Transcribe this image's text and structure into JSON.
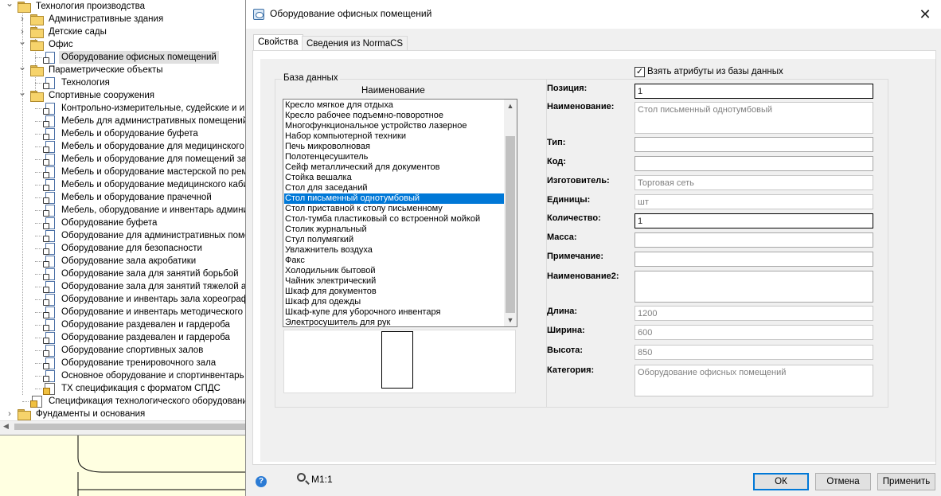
{
  "tree": {
    "nodes": [
      {
        "label": "Технология производства",
        "icon": "folder-icon",
        "toggle": "expanded"
      },
      {
        "label": "Административные здания",
        "icon": "folder-icon",
        "toggle": "collapsed"
      },
      {
        "label": "Детские сады",
        "icon": "folder-icon",
        "toggle": "collapsed"
      },
      {
        "label": "Офис",
        "icon": "folder-icon",
        "toggle": "expanded"
      },
      {
        "label": "Оборудование офисных помещений",
        "icon": "document-icon",
        "toggle": "none",
        "selected": true
      },
      {
        "label": "Параметрические объекты",
        "icon": "folder-icon",
        "toggle": "expanded"
      },
      {
        "label": "Технология",
        "icon": "document-icon",
        "toggle": "none"
      },
      {
        "label": "Спортивные сооружения",
        "icon": "folder-icon",
        "toggle": "expanded"
      },
      {
        "label": "Контрольно-измерительные, судейские и ин",
        "icon": "document-icon",
        "toggle": "none"
      },
      {
        "label": "Мебель для административных помещений",
        "icon": "document-icon",
        "toggle": "none"
      },
      {
        "label": "Мебель и оборудование буфета",
        "icon": "document-icon",
        "toggle": "none"
      },
      {
        "label": "Мебель и оборудование для медицинского к",
        "icon": "document-icon",
        "toggle": "none"
      },
      {
        "label": "Мебель и оборудование для помещений зат",
        "icon": "document-icon",
        "toggle": "none"
      },
      {
        "label": "Мебель и оборудование мастерской по ремс",
        "icon": "document-icon",
        "toggle": "none"
      },
      {
        "label": "Мебель и оборудование медицинского каби",
        "icon": "document-icon",
        "toggle": "none"
      },
      {
        "label": "Мебель и оборудование прачечной",
        "icon": "document-icon",
        "toggle": "none"
      },
      {
        "label": "Мебель, оборудование и инвентарь админис",
        "icon": "document-icon",
        "toggle": "none"
      },
      {
        "label": "Оборудование буфета",
        "icon": "document-icon",
        "toggle": "none"
      },
      {
        "label": "Оборудование для административных помещ",
        "icon": "document-icon",
        "toggle": "none"
      },
      {
        "label": "Оборудование для безопасности",
        "icon": "document-icon",
        "toggle": "none"
      },
      {
        "label": "Оборудование зала акробатики",
        "icon": "document-icon",
        "toggle": "none"
      },
      {
        "label": "Оборудование зала для занятий борьбой",
        "icon": "document-icon",
        "toggle": "none"
      },
      {
        "label": "Оборудование зала для занятий тяжелой ат",
        "icon": "document-icon",
        "toggle": "none"
      },
      {
        "label": "Оборудование и инвентарь зала хореографи",
        "icon": "document-icon",
        "toggle": "none"
      },
      {
        "label": "Оборудование и инвентарь методического к",
        "icon": "document-icon",
        "toggle": "none"
      },
      {
        "label": "Оборудование раздевален и гардероба",
        "icon": "document-icon",
        "toggle": "none"
      },
      {
        "label": "Оборудование раздевален и гардероба",
        "icon": "document-icon",
        "toggle": "none"
      },
      {
        "label": "Оборудование спортивных залов",
        "icon": "document-icon",
        "toggle": "none"
      },
      {
        "label": "Оборудование тренировочного зала",
        "icon": "document-icon",
        "toggle": "none"
      },
      {
        "label": "Основное оборудование и спортинвентарь",
        "icon": "document-icon",
        "toggle": "none"
      },
      {
        "label": "ТХ спецификация с форматом СПДС",
        "icon": "spec-document-icon",
        "toggle": "none"
      },
      {
        "label": "Спецификация технологического оборудования",
        "icon": "spec-table-icon",
        "toggle": "none"
      },
      {
        "label": "Фундаменты и основания",
        "icon": "folder-icon",
        "toggle": "collapsed"
      }
    ]
  },
  "dialog": {
    "title": "Оборудование офисных помещений",
    "close_glyph": "✕",
    "tabs": [
      {
        "label": "Свойства",
        "active": true
      },
      {
        "label": "Сведения из NormaCS",
        "active": false
      }
    ],
    "group_title": "База данных",
    "list_header": "Наименование",
    "list_items": [
      "Кресло мягкое для отдыха",
      "Кресло рабочее подъемно-поворотное",
      "Многофункциональное устройство лазерное",
      "Набор компьютерной техники",
      "Печь микроволновая",
      "Полотенцесушитель",
      "Сейф металлический для документов",
      "Стойка вешалка",
      "Стол для заседаний",
      "Стол письменный однотумбовый",
      "Стол приставной к столу письменному",
      "Стол-тумба пластиковый со встроенной мойкой",
      "Столик журнальный",
      "Стул полумягкий",
      "Увлажнитель воздуха",
      "Факс",
      "Холодильник бытовой",
      "Чайник электрический",
      "Шкаф для документов",
      "Шкаф для одежды",
      "Шкаф-купе для уборочного инвентаря",
      "Электросушитель для рук"
    ],
    "selected_item": "Стол письменный однотумбовый",
    "take_attributes": {
      "label": "Взять атрибуты из базы данных",
      "checked": true,
      "check_glyph": "✓"
    },
    "fields": [
      {
        "label": "Позиция:",
        "value": "1"
      },
      {
        "label": "Наименование:",
        "value": "Стол письменный однотумбовый"
      },
      {
        "label": "Тип:",
        "value": ""
      },
      {
        "label": "Код:",
        "value": ""
      },
      {
        "label": "Изготовитель:",
        "value": "Торговая сеть"
      },
      {
        "label": "Единицы:",
        "value": "шт"
      },
      {
        "label": "Количество:",
        "value": "1"
      },
      {
        "label": "Масса:",
        "value": ""
      },
      {
        "label": "Примечание:",
        "value": ""
      },
      {
        "label": "Наименование2:",
        "value": ""
      },
      {
        "label": "Длина:",
        "value": "1200"
      },
      {
        "label": "Ширина:",
        "value": "600"
      },
      {
        "label": "Высота:",
        "value": "850"
      },
      {
        "label": "Категория:",
        "value": "Оборудование офисных помещений"
      }
    ],
    "help_glyph": "?",
    "scale_label": "М1:1",
    "buttons": {
      "ok": "ОК",
      "cancel": "Отмена",
      "apply": "Применить"
    }
  }
}
